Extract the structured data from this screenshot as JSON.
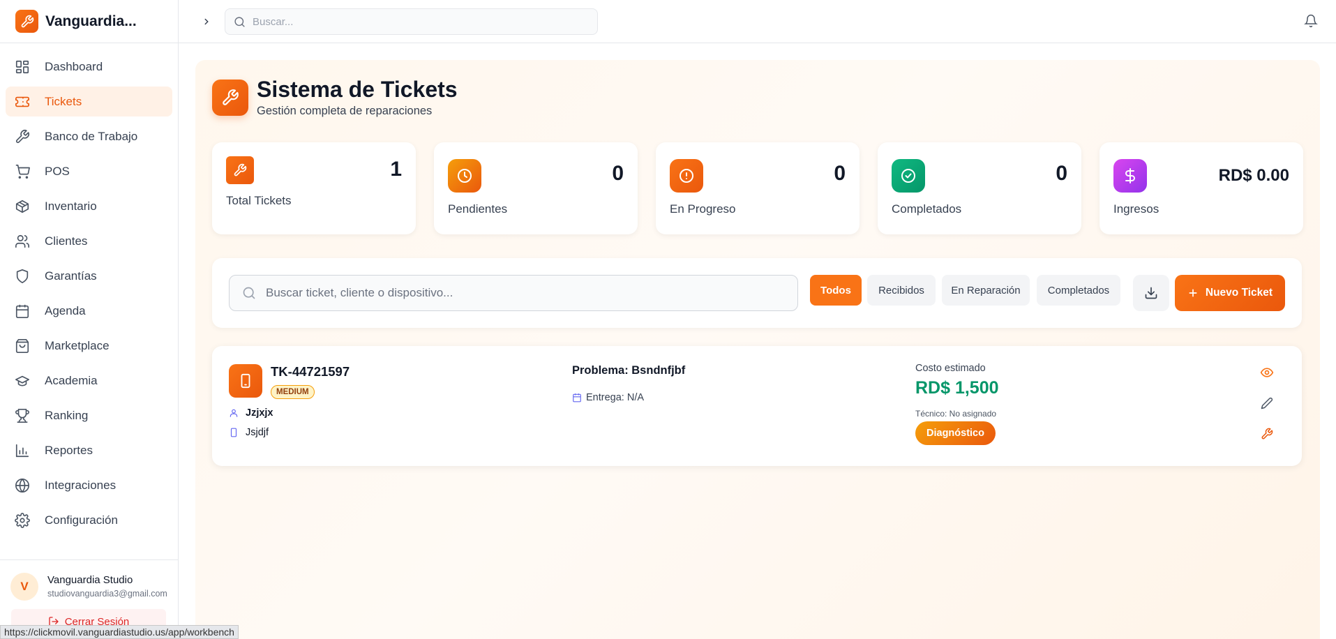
{
  "app": {
    "name": "Vanguardia..."
  },
  "colors": {
    "accent": "#f97316",
    "accent_dark": "#ea580c",
    "success": "#059669"
  },
  "sidebar": {
    "items": [
      {
        "label": "Dashboard",
        "icon": "dashboard-icon"
      },
      {
        "label": "Tickets",
        "icon": "ticket-icon",
        "active": true
      },
      {
        "label": "Banco de Trabajo",
        "icon": "wrench-icon"
      },
      {
        "label": "POS",
        "icon": "cart-icon"
      },
      {
        "label": "Inventario",
        "icon": "box-icon"
      },
      {
        "label": "Clientes",
        "icon": "users-icon"
      },
      {
        "label": "Garantías",
        "icon": "shield-icon"
      },
      {
        "label": "Agenda",
        "icon": "calendar-icon"
      },
      {
        "label": "Marketplace",
        "icon": "shopping-bag-icon"
      },
      {
        "label": "Academia",
        "icon": "graduation-cap-icon"
      },
      {
        "label": "Ranking",
        "icon": "trophy-icon"
      },
      {
        "label": "Reportes",
        "icon": "bar-chart-icon"
      },
      {
        "label": "Integraciones",
        "icon": "globe-icon"
      },
      {
        "label": "Configuración",
        "icon": "gear-icon"
      }
    ],
    "user": {
      "initial": "V",
      "name": "Vanguardia Studio",
      "email": "studiovanguardia3@gmail.com"
    },
    "logout_label": "Cerrar Sesión"
  },
  "topbar": {
    "search_placeholder": "Buscar..."
  },
  "status_url": "https://clickmovil.vanguardiastudio.us/app/workbench",
  "page": {
    "title": "Sistema de Tickets",
    "subtitle": "Gestión completa de reparaciones"
  },
  "stats": [
    {
      "value": "1",
      "label": "Total Tickets"
    },
    {
      "value": "0",
      "label": "Pendientes"
    },
    {
      "value": "0",
      "label": "En Progreso"
    },
    {
      "value": "0",
      "label": "Completados"
    },
    {
      "value": "RD$ 0.00",
      "label": "Ingresos"
    }
  ],
  "filters": {
    "search_placeholder": "Buscar ticket, cliente o dispositivo...",
    "buttons": [
      "Todos",
      "Recibidos",
      "En Reparación",
      "Completados"
    ],
    "active": "Todos",
    "new_ticket_label": "Nuevo Ticket"
  },
  "tickets": [
    {
      "id": "TK-44721597",
      "priority": "MEDIUM",
      "customer": "Jzjxjx",
      "device": "Jsjdjf",
      "problem": "Problema: Bsndnfjbf",
      "delivery": "Entrega: N/A",
      "cost_label": "Costo estimado",
      "cost": "RD$ 1,500",
      "technician": "Técnico: No asignado",
      "status": "Diagnóstico"
    }
  ]
}
